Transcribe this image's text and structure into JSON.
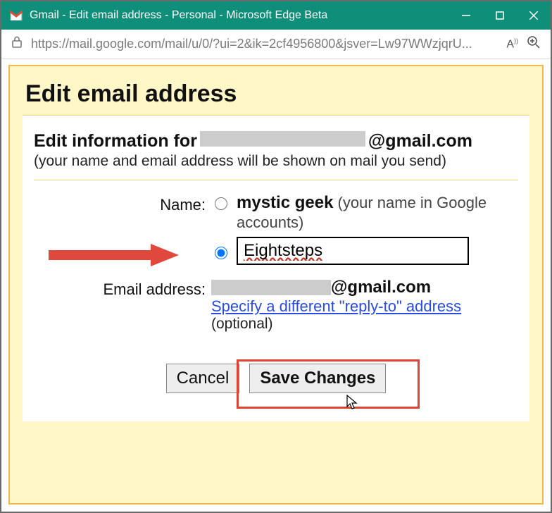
{
  "window": {
    "title": "Gmail - Edit email address - Personal - Microsoft Edge Beta"
  },
  "urlbar": {
    "url": "https://mail.google.com/mail/u/0/?ui=2&ik=2cf4956800&jsver=Lw97WWzjqrU..."
  },
  "page": {
    "title": "Edit email address",
    "info_prefix": "Edit information for",
    "email_domain": "@gmail.com",
    "sub_note": "(your name and email address will be shown on mail you send)"
  },
  "form": {
    "name_label": "Name:",
    "option1_name": "mystic geek",
    "option1_note_open": " (your name in Google",
    "option1_note_accounts": "accounts)",
    "option2_value": "Eightsteps",
    "email_label": "Email address:",
    "email_domain": "@gmail.com",
    "reply_to_link": "Specify a different \"reply-to\" address",
    "optional_note": "(optional)"
  },
  "buttons": {
    "cancel": "Cancel",
    "save": "Save Changes"
  }
}
